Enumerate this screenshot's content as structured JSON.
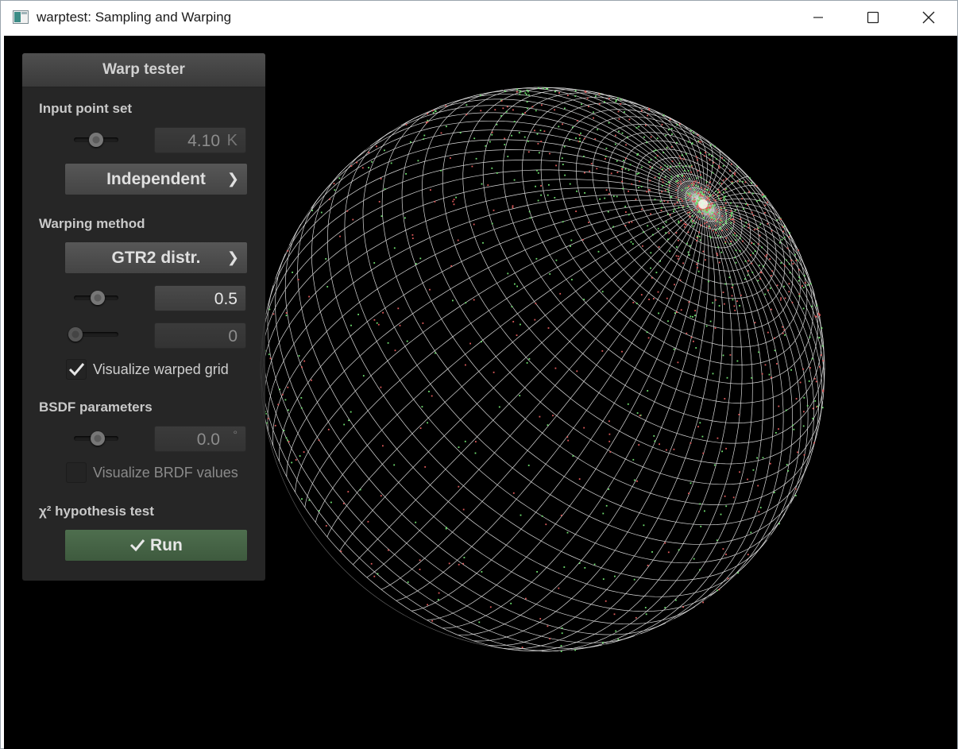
{
  "window": {
    "title": "warptest: Sampling and Warping",
    "icons": {
      "app": "app-window-icon",
      "minimize": "minimize-icon",
      "maximize": "maximize-icon",
      "close": "close-icon"
    }
  },
  "panel": {
    "title": "Warp tester",
    "input_point_set": {
      "label": "Input point set",
      "count_value": "4.10",
      "count_unit": "K",
      "slider_level": 0.42,
      "method": "Independent"
    },
    "warping_method": {
      "label": "Warping method",
      "method": "GTR2 distr.",
      "param1_value": "0.5",
      "param1_slider_level": 0.5,
      "param2_value": "0",
      "param2_slider_level": 0.0,
      "grid_checkbox_label": "Visualize warped grid",
      "grid_checked": true
    },
    "bsdf": {
      "label": "BSDF parameters",
      "angle_value": "0.0",
      "angle_unit": "°",
      "slider_level": 0.5,
      "brdf_checkbox_label": "Visualize BRDF values",
      "brdf_checked": false
    },
    "chi2": {
      "label": "χ² hypothesis test",
      "run_label": "Run"
    }
  },
  "colors": {
    "background": "#000000",
    "grid": "#ffffff",
    "point_red": "#e05a5a",
    "point_green": "#6fe06f",
    "run_button": "#4e6e4e"
  }
}
